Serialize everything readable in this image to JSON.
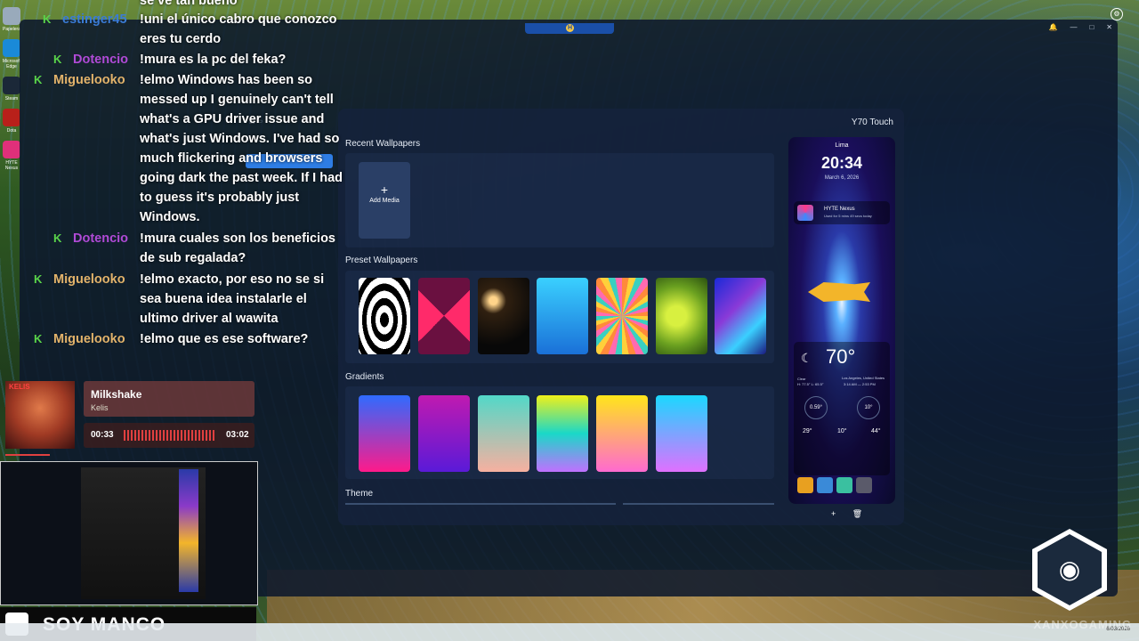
{
  "chat": [
    {
      "user": "estinger45",
      "color": "#3a7bd5",
      "badge": "K",
      "text": "se ve tan bueno"
    },
    {
      "user": "estinger45",
      "color": "#3a7bd5",
      "badge": "K",
      "text": "!uni el único cabro que conozco eres tu cerdo"
    },
    {
      "user": "Dotencio",
      "color": "#b04ad6",
      "badge": "K",
      "text": "!mura es la pc del feka?"
    },
    {
      "user": "Miguelooko",
      "color": "#e3b36a",
      "badge": "K",
      "text": "!elmo Windows has been so messed up I genuinely can't tell what's a GPU driver issue and what's just Windows. I've had so much flickering and browsers going dark the past week. If I had to guess it's probably just Windows."
    },
    {
      "user": "Dotencio",
      "color": "#b04ad6",
      "badge": "K",
      "text": "!mura cuales son los beneficios de sub regalada?"
    },
    {
      "user": "Miguelooko",
      "color": "#e3b36a",
      "badge": "K",
      "text": "!elmo exacto, por eso no se si sea buena idea instalarle el ultimo driver al wawita"
    },
    {
      "user": "Miguelooko",
      "color": "#e3b36a",
      "badge": "K",
      "text": "!elmo que es ese software?"
    }
  ],
  "panel": {
    "device_name": "Y70 Touch",
    "recent_title": "Recent Wallpapers",
    "add_media_label": "Add Media",
    "add_media_plus": "+",
    "preset_title": "Preset Wallpapers",
    "gradients_title": "Gradients",
    "theme_title": "Theme",
    "preset_icons": [
      "abstract-swirl-icon",
      "neon-diamond-icon",
      "planet-icon",
      "koi-fish-icon",
      "retro-burst-icon",
      "leaf-icon",
      "liquid-chrome-icon"
    ],
    "gradient_colors": [
      [
        "#2f6bff",
        "#ff1a8a"
      ],
      [
        "#c01ab0",
        "#5a1ad8"
      ],
      [
        "#52d8c8",
        "#f7b0a0"
      ],
      [
        "#f0f01a",
        "#1ad8c8",
        "#c070ff"
      ],
      [
        "#ffe61a",
        "#ff6ad0"
      ],
      [
        "#1ad8ff",
        "#e070ff"
      ]
    ]
  },
  "phone": {
    "city": "Lima",
    "time": "20:34",
    "date": "March 6, 2026",
    "nexus_title": "HYTE Nexus",
    "nexus_sub": "Used for 5 mins 49 secs today",
    "weather_temp": "70°",
    "weather_cond": "Clear",
    "weather_range": "H: 77.5° L: 65.5°",
    "weather_place": "Los Angeles, United States",
    "weather_time": "3:14 AM — 2:53 PM",
    "gauge1": "0.59°",
    "gauge2": "10°",
    "stat1": "29°",
    "stat2": "10°",
    "stat3": "44°",
    "actions": "+ 🗑"
  },
  "music": {
    "title": "Milkshake",
    "artist": "Kelis",
    "elapsed": "00:33",
    "duration": "03:02",
    "album_text": "KELIS"
  },
  "stream": {
    "brand": "SOY MANCO",
    "watermark": "XANXOGAMING"
  },
  "desktop_icons": [
    {
      "label": "Papelera",
      "color": "#9ab"
    },
    {
      "label": "Microsoft Edge",
      "color": "#1a8ad8"
    },
    {
      "label": "Steam",
      "color": "#1b2838"
    },
    {
      "label": "Dota",
      "color": "#b8201a"
    },
    {
      "label": "HYTE Nexus",
      "color": "#e0307a"
    }
  ],
  "tray": {
    "date": "6/03/2026"
  },
  "topbar_letter": "H"
}
